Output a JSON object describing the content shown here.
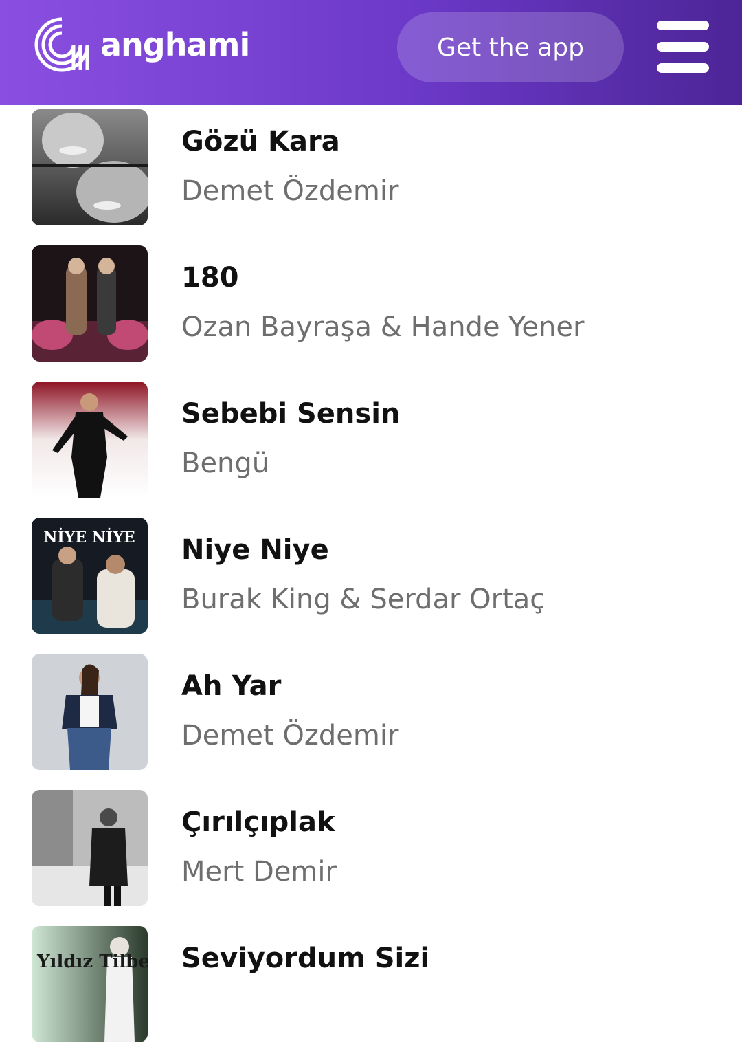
{
  "header": {
    "brand": "anghami",
    "get_app_label": "Get the app",
    "logo_icon": "anghami-logo-icon",
    "menu_icon": "hamburger-menu-icon"
  },
  "songs": [
    {
      "title": "Gözü Kara",
      "artist": "Demet Özdemir"
    },
    {
      "title": "180",
      "artist": "Ozan Bayraşa & Hande Yener"
    },
    {
      "title": "Sebebi Sensin",
      "artist": "Bengü"
    },
    {
      "title": "Niye Niye",
      "artist": "Burak King & Serdar Ortaç",
      "cover_text": "NİYE NİYE"
    },
    {
      "title": "Ah Yar",
      "artist": "Demet Özdemir"
    },
    {
      "title": "Çırılçıplak",
      "artist": "Mert Demir"
    },
    {
      "title": "Seviyordum Sizi",
      "artist": "",
      "cover_text": "Yıldız Tilbe"
    }
  ],
  "colors": {
    "header_start": "#8a4fe0",
    "header_end": "#4d2597",
    "title": "#111111",
    "artist": "#6e6e6e"
  }
}
